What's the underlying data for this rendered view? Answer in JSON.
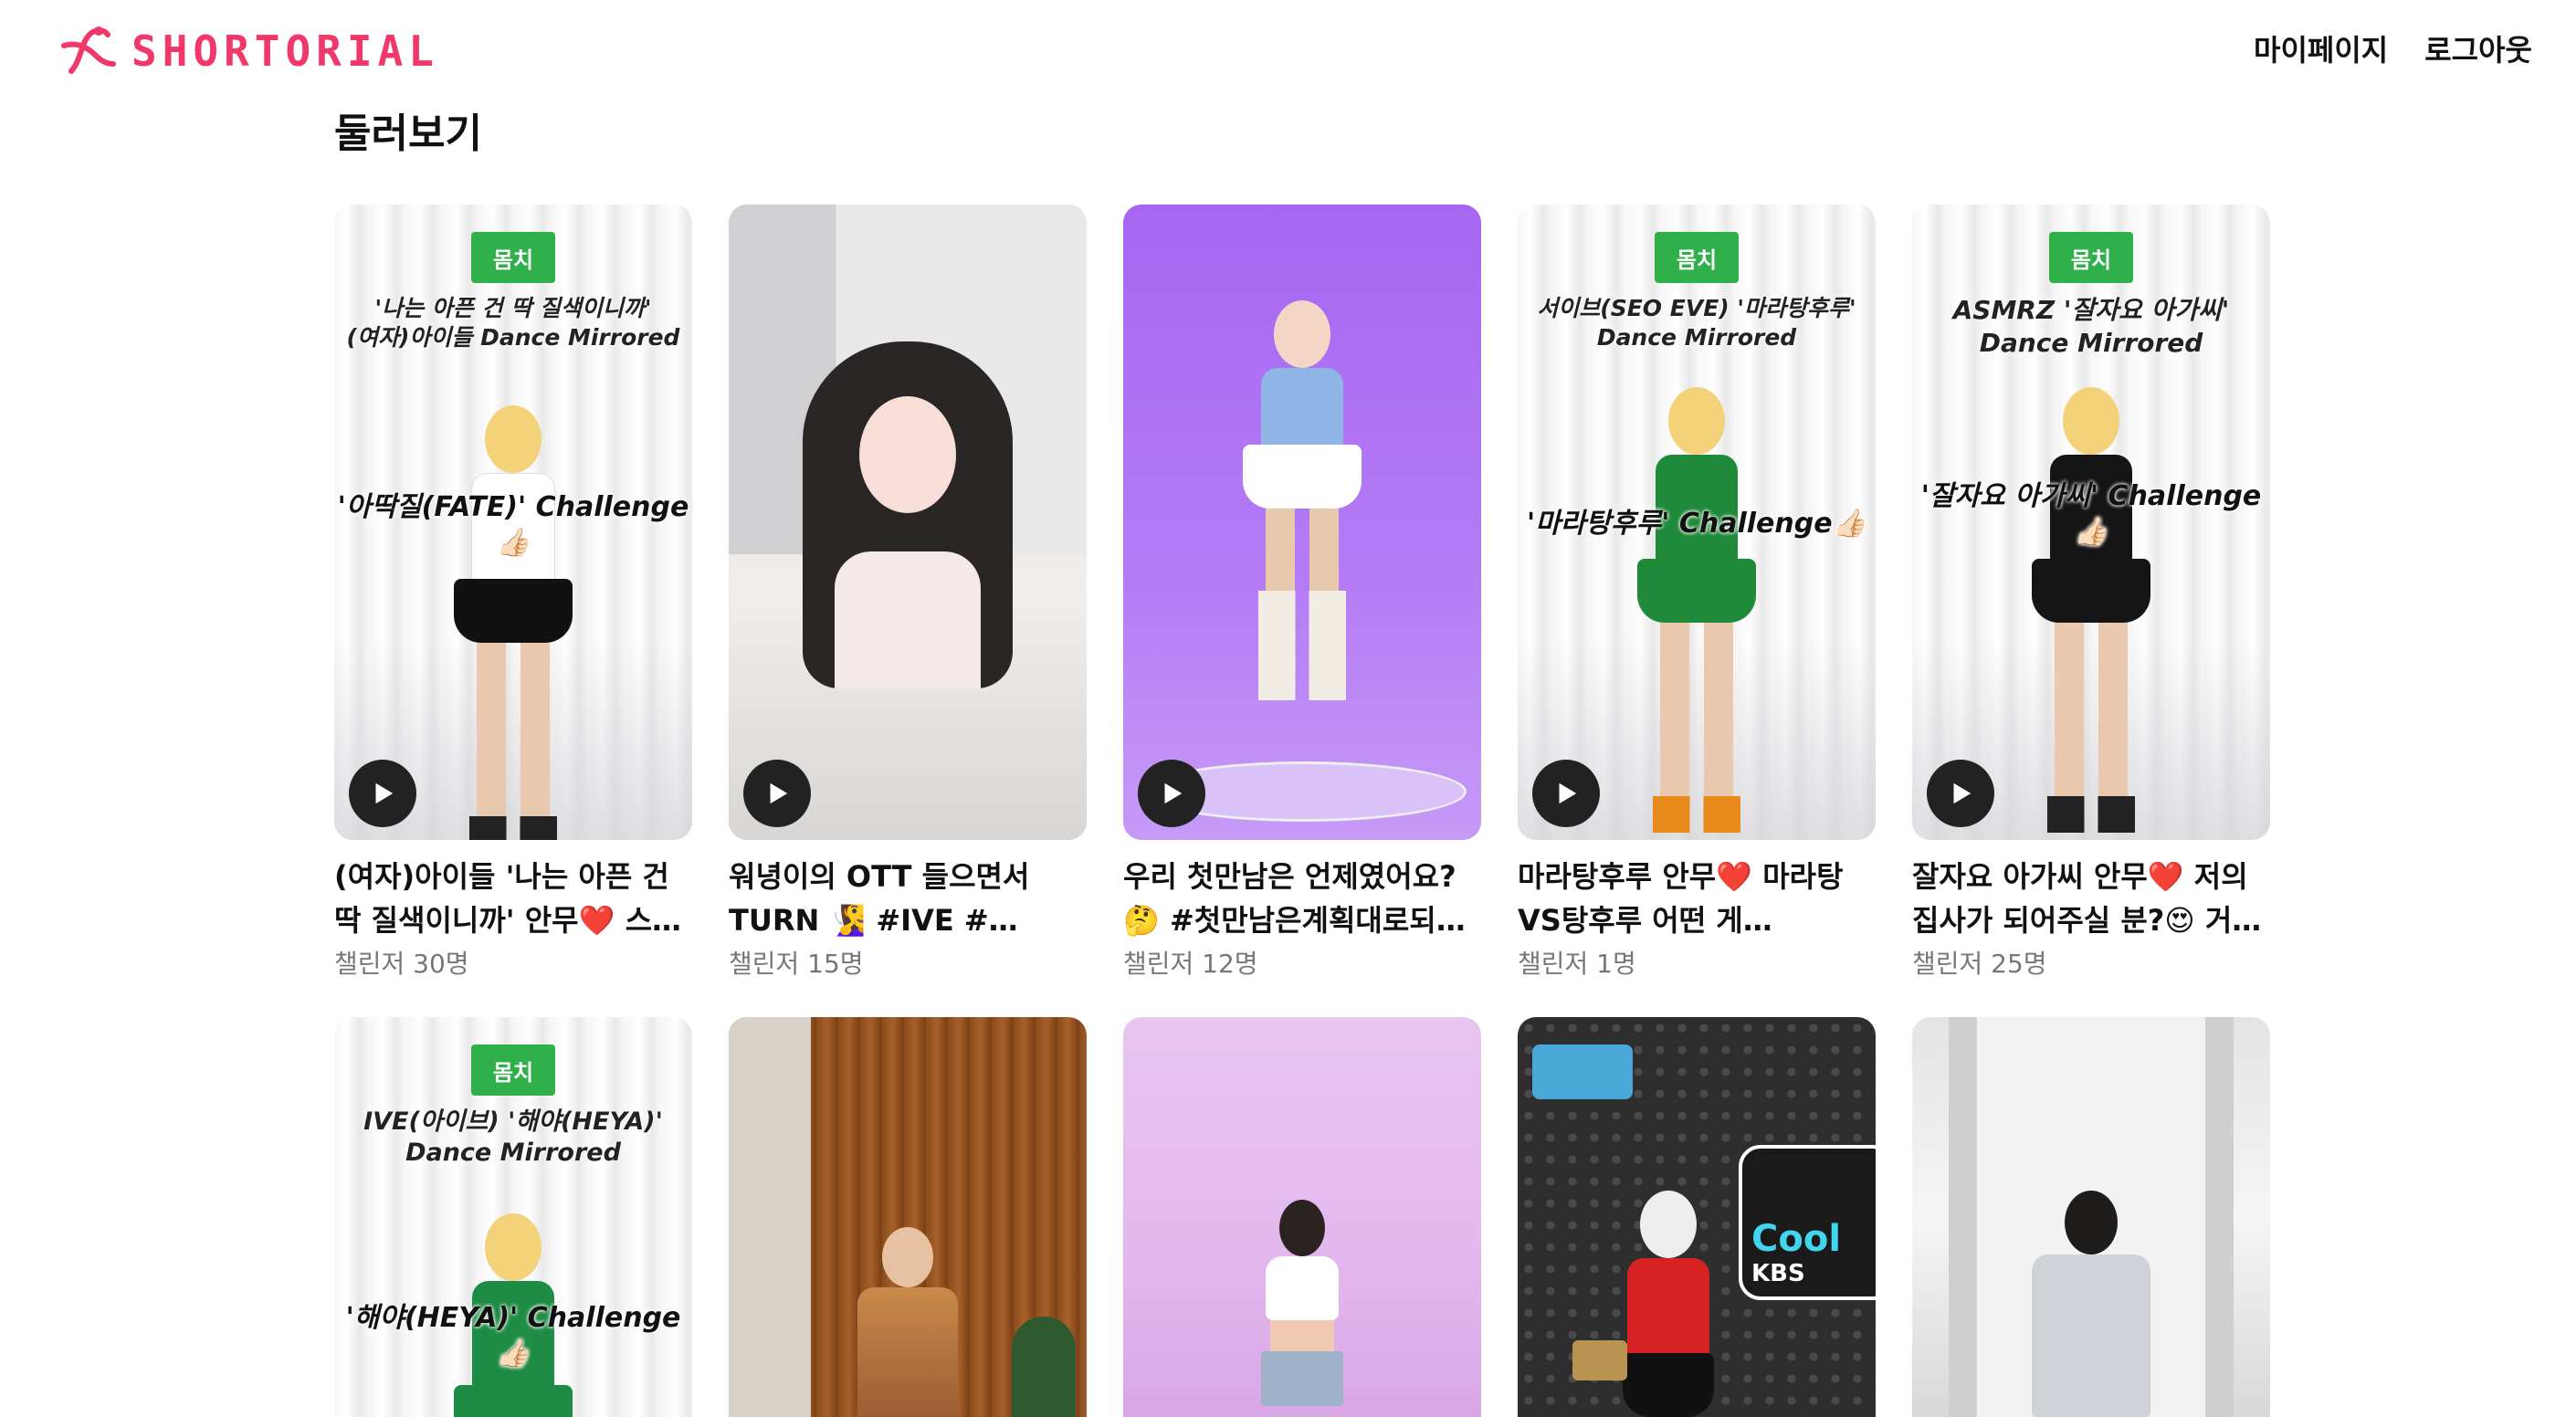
{
  "header": {
    "logo_text": "SHORTORIAL",
    "brand_color": "#f0386b",
    "nav": {
      "mypage_label": "마이페이지",
      "logout_label": "로그아웃"
    }
  },
  "main": {
    "section_title": "둘러보기",
    "cards": [
      {
        "title": "(여자)아이들 '나는 아픈 건 딱 질색이니까' 안무❤️ 스…",
        "challengers": "챌린저 30명",
        "overlay_line1": "'나는 아픈 건 딱 질색이니까'",
        "overlay_line2": "(여자)아이들 Dance Mirrored",
        "overlay_challenge": "'아딱질(FATE)' Challenge👍🏻",
        "sign": "몸치"
      },
      {
        "title": "워녕이의 OTT 들으면서 TURN 🧏‍♀️ #IVE #아이브…",
        "challengers": "챌린저 15명"
      },
      {
        "title": "우리 첫만남은 언제였어요? 🤔 #첫만남은계획대로되…",
        "challengers": "챌린저 12명"
      },
      {
        "title": "마라탕후루 안무❤️ 마라탕 VS탕후루 어떤 게 좋아요?…",
        "challengers": "챌린저 1명",
        "overlay_line1": "서이브(SEO EVE) '마라탕후루'",
        "overlay_line2": "Dance Mirrored",
        "overlay_challenge": "'마라탕후루' Challenge👍🏻",
        "sign": "몸치"
      },
      {
        "title": "잘자요 아가씨 안무❤️ 저의 집사가 되어주실 분?😍 거…",
        "challengers": "챌린저 25명",
        "overlay_line1": "ASMRZ '잘자요 아가씨'",
        "overlay_line2": "Dance Mirrored",
        "overlay_challenge": "'잘자요 아가씨' Challenge👍🏻",
        "sign": "몸치"
      },
      {
        "overlay_line1": "IVE(아이브) '해야(HEYA)'",
        "overlay_line2": "Dance Mirrored",
        "overlay_challenge": "'해야(HEYA)' Challenge👍🏻",
        "sign": "몸치"
      },
      {},
      {},
      {
        "sign_label": "Cool",
        "station": "KBS"
      },
      {}
    ]
  }
}
